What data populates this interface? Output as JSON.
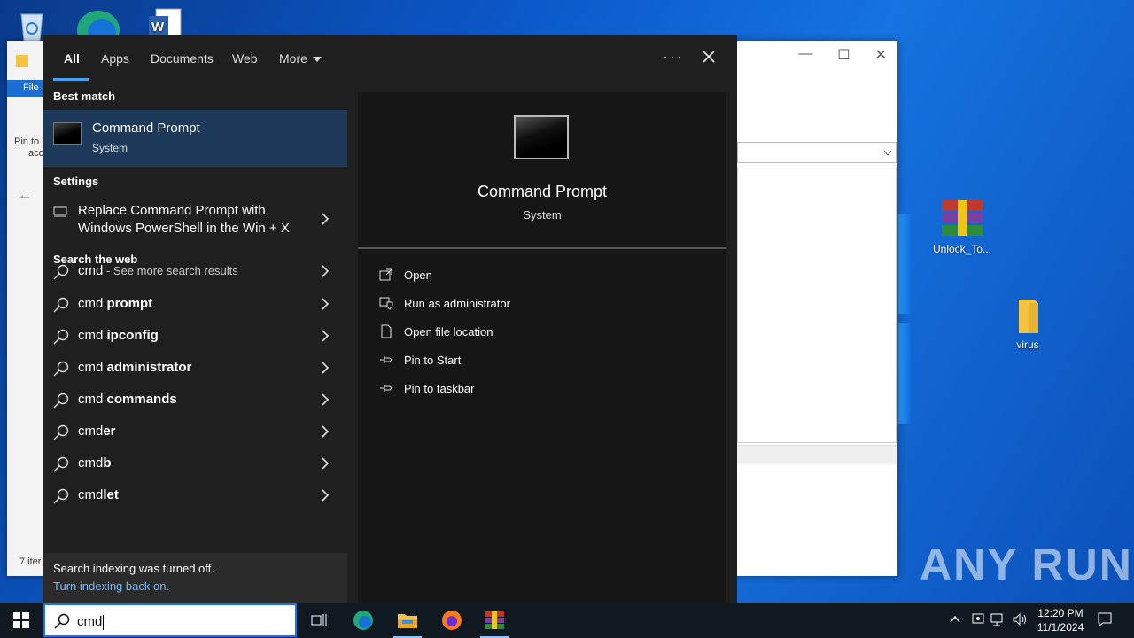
{
  "desktop": {
    "icons": [
      {
        "label": "Unlock_To..."
      },
      {
        "label": "virus"
      }
    ]
  },
  "explorer": {
    "ribbon_tab": "File",
    "pin_text": "Pin to",
    "pin_text2": "acc",
    "status_text": "7 iter"
  },
  "search": {
    "tabs": [
      "All",
      "Apps",
      "Documents",
      "Web",
      "More"
    ],
    "more_menu_icon": "ellipsis-icon",
    "best_match": {
      "heading": "Best match",
      "title": "Command Prompt",
      "subtitle": "System"
    },
    "settings": {
      "heading": "Settings",
      "item": "Replace Command Prompt with Windows PowerShell in the Win + X"
    },
    "web": {
      "heading": "Search the web",
      "items": [
        {
          "query": "cmd",
          "bold": "",
          "suffix": " - See more search results"
        },
        {
          "query": "cmd ",
          "bold": "prompt",
          "suffix": ""
        },
        {
          "query": "cmd ",
          "bold": "ipconfig",
          "suffix": ""
        },
        {
          "query": "cmd ",
          "bold": "administrator",
          "suffix": ""
        },
        {
          "query": "cmd ",
          "bold": "commands",
          "suffix": ""
        },
        {
          "query": "cmd",
          "bold": "er",
          "suffix": ""
        },
        {
          "query": "cmd",
          "bold": "b",
          "suffix": ""
        },
        {
          "query": "cmd",
          "bold": "let",
          "suffix": ""
        }
      ]
    },
    "footer": {
      "notice": "Search indexing was turned off.",
      "link": "Turn indexing back on."
    },
    "detail": {
      "title": "Command Prompt",
      "subtitle": "System",
      "actions": [
        "Open",
        "Run as administrator",
        "Open file location",
        "Pin to Start",
        "Pin to taskbar"
      ]
    }
  },
  "taskbar": {
    "search_value": "cmd",
    "time": "12:20 PM",
    "date": "11/1/2024"
  },
  "watermark": "ANY RUN"
}
